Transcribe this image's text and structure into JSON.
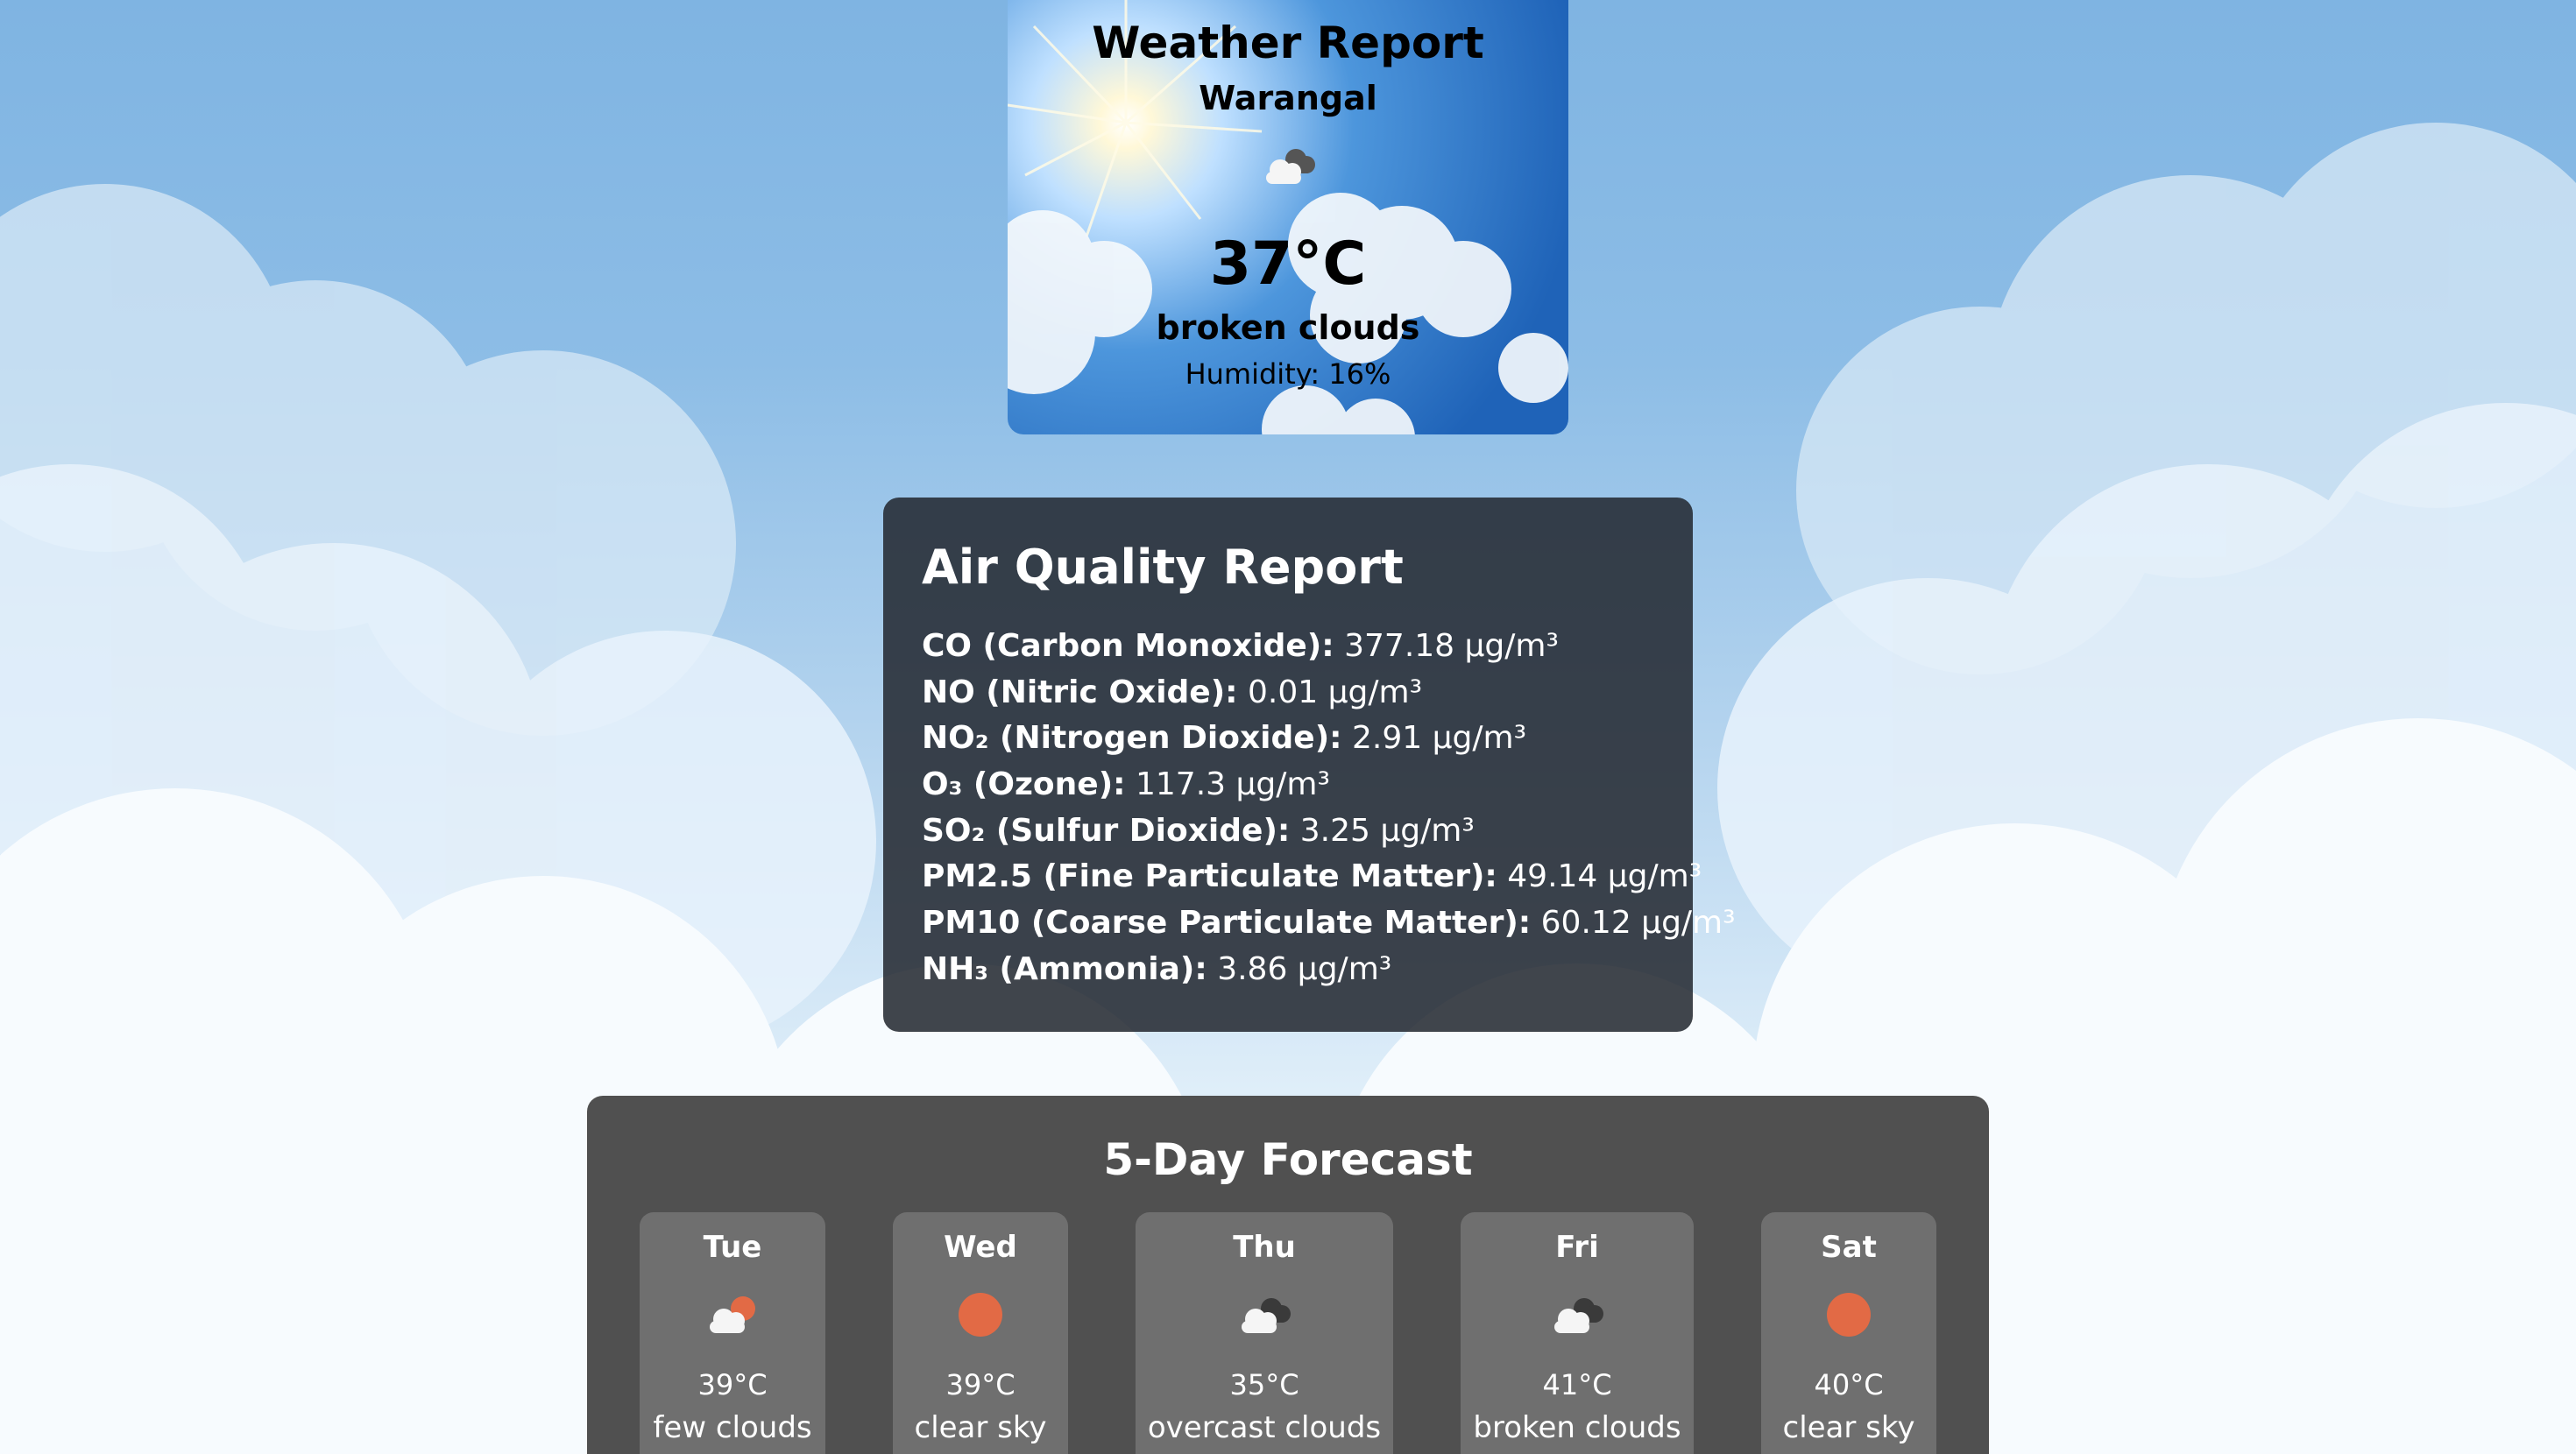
{
  "weather": {
    "title": "Weather Report",
    "city": "Warangal",
    "icon": "broken-clouds-icon",
    "temperature": "37°C",
    "description": "broken clouds",
    "humidity": "Humidity: 16%"
  },
  "air_quality": {
    "title": "Air Quality Report",
    "items": [
      {
        "label": "CO (Carbon Monoxide):",
        "value": "377.18 μg/m³"
      },
      {
        "label": "NO (Nitric Oxide):",
        "value": "0.01 μg/m³"
      },
      {
        "label": "NO₂ (Nitrogen Dioxide):",
        "value": "2.91 μg/m³"
      },
      {
        "label": "O₃ (Ozone):",
        "value": "117.3 μg/m³"
      },
      {
        "label": "SO₂ (Sulfur Dioxide):",
        "value": "3.25 μg/m³"
      },
      {
        "label": "PM2.5 (Fine Particulate Matter):",
        "value": "49.14 μg/m³"
      },
      {
        "label": "PM10 (Coarse Particulate Matter):",
        "value": "60.12 μg/m³"
      },
      {
        "label": "NH₃ (Ammonia):",
        "value": "3.86 μg/m³"
      }
    ]
  },
  "forecast": {
    "title": "5-Day Forecast",
    "days": [
      {
        "day": "Tue",
        "icon": "few-clouds-icon",
        "temp": "39°C",
        "desc": "few clouds"
      },
      {
        "day": "Wed",
        "icon": "clear-sky-icon",
        "temp": "39°C",
        "desc": "clear sky"
      },
      {
        "day": "Thu",
        "icon": "overcast-clouds-icon",
        "temp": "35°C",
        "desc": "overcast clouds"
      },
      {
        "day": "Fri",
        "icon": "broken-clouds-icon",
        "temp": "41°C",
        "desc": "broken clouds"
      },
      {
        "day": "Sat",
        "icon": "clear-sky-icon",
        "temp": "40°C",
        "desc": "clear sky"
      }
    ]
  },
  "colors": {
    "sun": "#e26a45",
    "aq_panel": "#2a2f36",
    "forecast_panel": "#505050",
    "forecast_tile": "#6f6f6f"
  }
}
